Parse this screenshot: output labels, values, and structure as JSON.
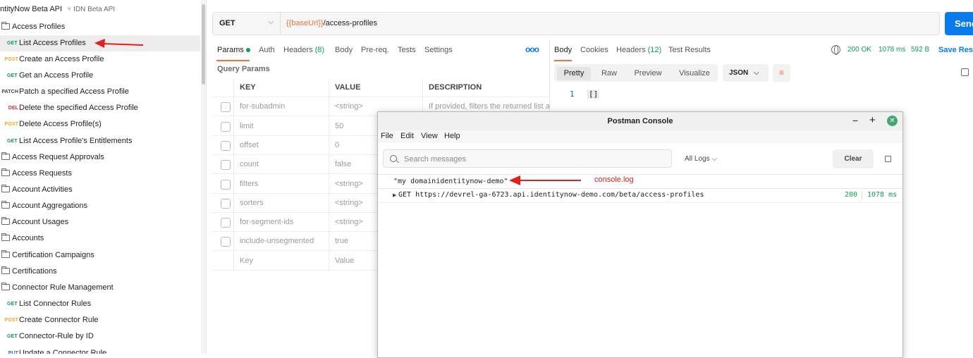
{
  "sidebar": {
    "collection_name": "ntityNow Beta API",
    "collection_sub": "IDN Beta API",
    "items": [
      {
        "type": "folder",
        "label": "Access Profiles"
      },
      {
        "type": "request",
        "method": "GET",
        "label": "List Access Profiles",
        "selected": true
      },
      {
        "type": "request",
        "method": "POST",
        "label": "Create an Access Profile"
      },
      {
        "type": "request",
        "method": "GET",
        "label": "Get an Access Profile"
      },
      {
        "type": "request",
        "method": "PATCH",
        "label": "Patch a specified Access Profile"
      },
      {
        "type": "request",
        "method": "DEL",
        "label": "Delete the specified Access Profile"
      },
      {
        "type": "request",
        "method": "POST",
        "label": "Delete Access Profile(s)"
      },
      {
        "type": "request",
        "method": "GET",
        "label": "List Access Profile's Entitlements"
      },
      {
        "type": "folder",
        "label": "Access Request Approvals"
      },
      {
        "type": "folder",
        "label": "Access Requests"
      },
      {
        "type": "folder",
        "label": "Account Activities"
      },
      {
        "type": "folder",
        "label": "Account Aggregations"
      },
      {
        "type": "folder",
        "label": "Account Usages"
      },
      {
        "type": "folder",
        "label": "Accounts"
      },
      {
        "type": "folder",
        "label": "Certification Campaigns"
      },
      {
        "type": "folder",
        "label": "Certifications"
      },
      {
        "type": "folder",
        "label": "Connector Rule Management"
      },
      {
        "type": "request",
        "method": "GET",
        "label": "List Connector Rules"
      },
      {
        "type": "request",
        "method": "POST",
        "label": "Create Connector Rule"
      },
      {
        "type": "request",
        "method": "GET",
        "label": "Connector-Rule by ID"
      },
      {
        "type": "request",
        "method": "PUT",
        "label": "Update a Connector Rule"
      }
    ]
  },
  "request": {
    "method": "GET",
    "url_var": "{{baseUrl}}",
    "url_path": "/access-profiles",
    "send_label": "Send"
  },
  "request_tabs": {
    "params": "Params",
    "auth": "Auth",
    "headers": "Headers",
    "headers_count": "(8)",
    "body": "Body",
    "prereq": "Pre-req.",
    "tests": "Tests",
    "settings": "Settings",
    "more": "ooo"
  },
  "query_params": {
    "title": "Query Params",
    "headers": [
      "KEY",
      "VALUE",
      "DESCRIPTION"
    ],
    "rows": [
      {
        "key": "for-subadmin",
        "value": "<string>",
        "description": "If provided, filters the returned list ac"
      },
      {
        "key": "limit",
        "value": "50",
        "description": ""
      },
      {
        "key": "offset",
        "value": "0",
        "description": ""
      },
      {
        "key": "count",
        "value": "false",
        "description": ""
      },
      {
        "key": "filters",
        "value": "<string>",
        "description": ""
      },
      {
        "key": "sorters",
        "value": "<string>",
        "description": ""
      },
      {
        "key": "for-segment-ids",
        "value": "<string>",
        "description": ""
      },
      {
        "key": "include-unsegmented",
        "value": "true",
        "description": ""
      }
    ],
    "new_key_placeholder": "Key",
    "new_value_placeholder": "Value"
  },
  "response": {
    "tabs": {
      "body": "Body",
      "cookies": "Cookies",
      "headers": "Headers",
      "headers_count": "(12)",
      "test_results": "Test Results"
    },
    "status": "200 OK",
    "time": "1078 ms",
    "size": "592 B",
    "save_label": "Save Resp",
    "views": [
      "Pretty",
      "Raw",
      "Preview",
      "Visualize"
    ],
    "active_view": "Pretty",
    "format": "JSON",
    "line_number": "1",
    "body_text": "[]"
  },
  "console": {
    "title": "Postman Console",
    "menu": [
      "File",
      "Edit",
      "View",
      "Help"
    ],
    "search_placeholder": "Search messages",
    "log_filter": "All Logs",
    "clear_label": "Clear",
    "log_message": "\"my domainidentitynow-demo\"",
    "request_line": "GET https://devrel-ga-6723.api.identitynow-demo.com/beta/access-profiles",
    "request_status": "200",
    "request_time": "1078 ms"
  },
  "annotations": {
    "console_label": "console.log",
    "arrow_color": "#e02020"
  }
}
